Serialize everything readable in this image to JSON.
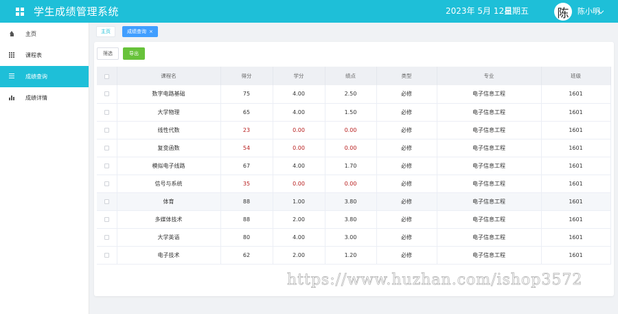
{
  "header": {
    "title": "学生成绩管理系统",
    "date": "2023年 5月 12日",
    "weekday": "星期五",
    "avatar_char": "陈",
    "username": "陈小明",
    "bg_color": "#1ebfd8"
  },
  "sidebar": {
    "items": [
      {
        "label": "主页",
        "icon": "home-icon"
      },
      {
        "label": "课程表",
        "icon": "grid-icon"
      },
      {
        "label": "成绩查询",
        "icon": "list-icon",
        "active": true
      },
      {
        "label": "成绩详情",
        "icon": "bar-chart-icon"
      }
    ]
  },
  "tabs": {
    "home": "主页",
    "active": "成绩查询",
    "close": "×"
  },
  "toolbar": {
    "filter_label": "筛选",
    "export_label": "导出"
  },
  "table": {
    "headers": [
      "课程名",
      "得分",
      "学分",
      "绩点",
      "类型",
      "专业",
      "班级"
    ],
    "rows": [
      {
        "course": "数字电路基础",
        "score": "75",
        "credit": "4.00",
        "gpa": "2.50",
        "type": "必修",
        "major": "电子信息工程",
        "class": "1601"
      },
      {
        "course": "大学物理",
        "score": "65",
        "credit": "4.00",
        "gpa": "1.50",
        "type": "必修",
        "major": "电子信息工程",
        "class": "1601"
      },
      {
        "course": "线性代数",
        "score": "23",
        "credit": "0.00",
        "gpa": "0.00",
        "type": "必修",
        "major": "电子信息工程",
        "class": "1601"
      },
      {
        "course": "复变函数",
        "score": "54",
        "credit": "0.00",
        "gpa": "0.00",
        "type": "必修",
        "major": "电子信息工程",
        "class": "1601"
      },
      {
        "course": "模拟电子线路",
        "score": "67",
        "credit": "4.00",
        "gpa": "1.70",
        "type": "必修",
        "major": "电子信息工程",
        "class": "1601"
      },
      {
        "course": "信号与系统",
        "score": "35",
        "credit": "0.00",
        "gpa": "0.00",
        "type": "必修",
        "major": "电子信息工程",
        "class": "1601"
      },
      {
        "course": "体育",
        "score": "88",
        "credit": "1.00",
        "gpa": "3.80",
        "type": "必修",
        "major": "电子信息工程",
        "class": "1601"
      },
      {
        "course": "多媒体技术",
        "score": "88",
        "credit": "2.00",
        "gpa": "3.80",
        "type": "必修",
        "major": "电子信息工程",
        "class": "1601"
      },
      {
        "course": "大学英语",
        "score": "80",
        "credit": "4.00",
        "gpa": "3.00",
        "type": "必修",
        "major": "电子信息工程",
        "class": "1601"
      },
      {
        "course": "电子技术",
        "score": "62",
        "credit": "2.00",
        "gpa": "1.20",
        "type": "必修",
        "major": "电子信息工程",
        "class": "1601"
      }
    ],
    "fail_color": "#b71c1c"
  },
  "watermark": "https://www.huzhan.com/ishop3572"
}
